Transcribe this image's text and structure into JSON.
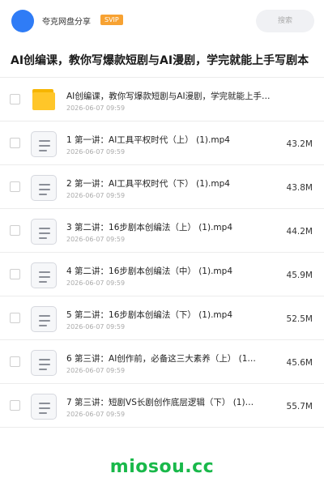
{
  "header": {
    "username": "夸克网盘分享",
    "badge": "SVIP",
    "search_placeholder": "搜索"
  },
  "title": "AI创编课，教你写爆款短剧与AI漫剧，学完就能上手写剧本",
  "files": [
    {
      "name": "AI创编课，教你写爆款短剧与AI漫剧，学完就能上手…",
      "date": "2026-06-07 09:59",
      "size": "",
      "type": "folder",
      "icon": "folder-icon"
    },
    {
      "name": "1 第一讲：AI工具平权时代（上） (1).mp4",
      "date": "2026-06-07 09:59",
      "size": "43.2M",
      "type": "file",
      "icon": "file-icon"
    },
    {
      "name": "2 第一讲：AI工具平权时代（下） (1).mp4",
      "date": "2026-06-07 09:59",
      "size": "43.8M",
      "type": "file",
      "icon": "file-icon"
    },
    {
      "name": "3 第二讲：16步剧本创编法（上） (1).mp4",
      "date": "2026-06-07 09:59",
      "size": "44.2M",
      "type": "file",
      "icon": "file-icon"
    },
    {
      "name": "4 第二讲：16步剧本创编法（中） (1).mp4",
      "date": "2026-06-07 09:59",
      "size": "45.9M",
      "type": "file",
      "icon": "file-icon"
    },
    {
      "name": "5 第二讲：16步剧本创编法（下） (1).mp4",
      "date": "2026-06-07 09:59",
      "size": "52.5M",
      "type": "file",
      "icon": "file-icon"
    },
    {
      "name": "6 第三讲：AI创作前，必备这三大素养（上） (1…",
      "date": "2026-06-07 09:59",
      "size": "45.6M",
      "type": "file",
      "icon": "file-icon"
    },
    {
      "name": "7 第三讲：短剧VS长剧创作底层逻辑（下） (1)…",
      "date": "2026-06-07 09:59",
      "size": "55.7M",
      "type": "file",
      "icon": "file-icon"
    }
  ],
  "watermark": "miosou.cc",
  "colors": {
    "accent": "#2f7cf6",
    "badge": "#f7a232",
    "folder": "#ffc629",
    "watermark": "#19b84a"
  }
}
